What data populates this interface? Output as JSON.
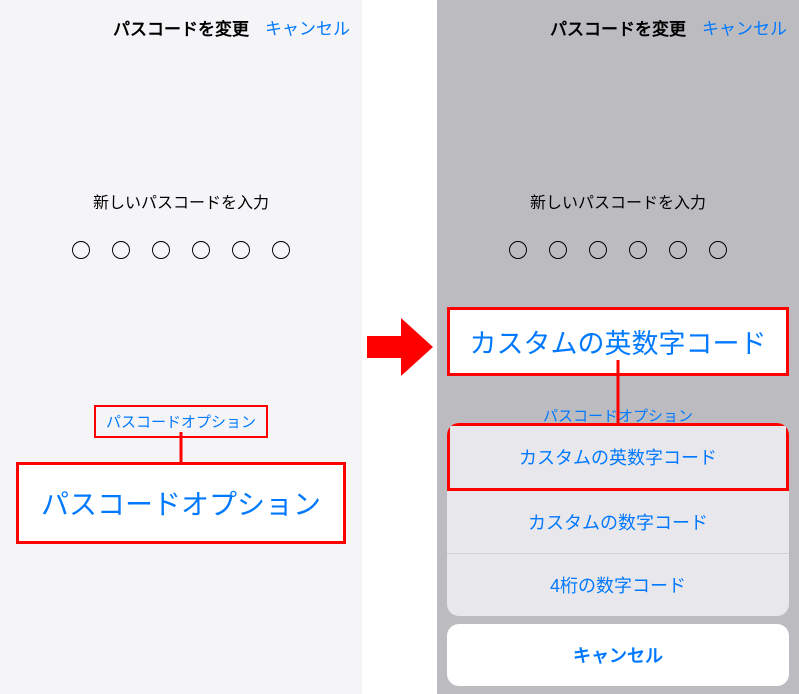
{
  "left": {
    "title": "パスコードを変更",
    "cancel": "キャンセル",
    "prompt": "新しいパスコードを入力",
    "options_link": "パスコードオプション",
    "callout": "パスコードオプション"
  },
  "right": {
    "title": "パスコードを変更",
    "cancel": "キャンセル",
    "prompt": "新しいパスコードを入力",
    "options_link": "パスコードオプション",
    "callout": "カスタムの英数字コード",
    "sheet": {
      "items": [
        "カスタムの英数字コード",
        "カスタムの数字コード",
        "4桁の数字コード"
      ],
      "cancel": "キャンセル"
    }
  }
}
